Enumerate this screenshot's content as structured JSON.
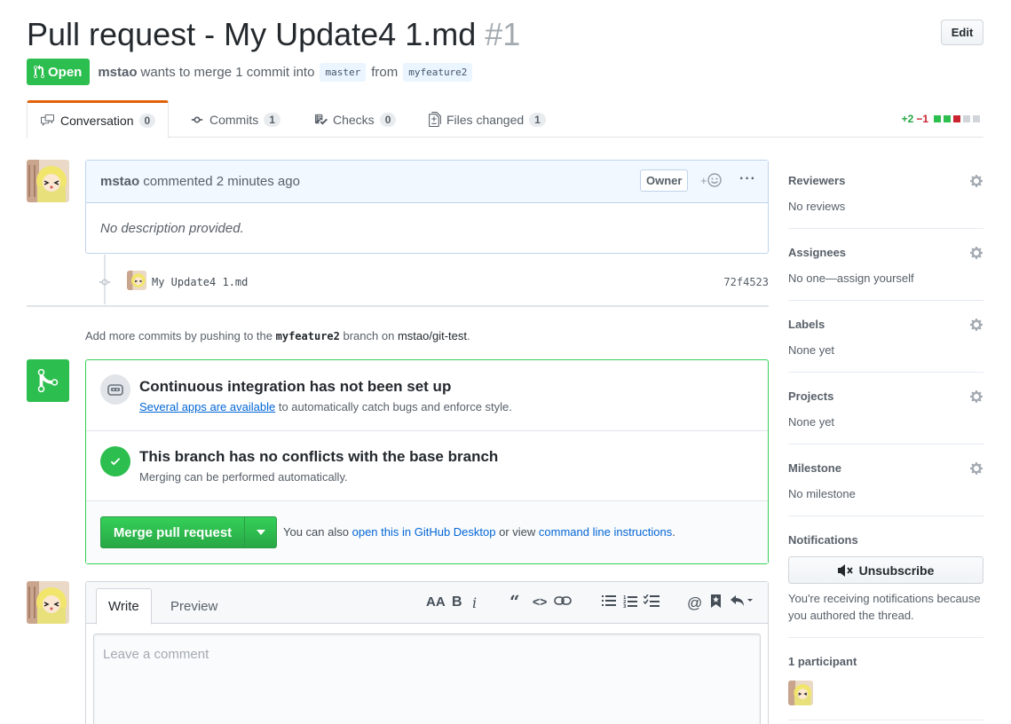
{
  "header": {
    "title": "Pull request - My Update4 1.md",
    "number": "#1",
    "edit_label": "Edit"
  },
  "meta": {
    "state": "Open",
    "author": "mstao",
    "wants_text": "wants to merge 1 commit into",
    "base_branch": "master",
    "from_text": "from",
    "head_branch": "myfeature2"
  },
  "tabs": [
    {
      "label": "Conversation",
      "count": "0"
    },
    {
      "label": "Commits",
      "count": "1"
    },
    {
      "label": "Checks",
      "count": "0"
    },
    {
      "label": "Files changed",
      "count": "1"
    }
  ],
  "diffstat": {
    "additions": "+2",
    "deletions": "−1"
  },
  "comment": {
    "author": "mstao",
    "action": "commented 2 minutes ago",
    "badge": "Owner",
    "body": "No description provided."
  },
  "commit": {
    "message": "My Update4 1.md",
    "sha": "72f4523"
  },
  "push_note": {
    "prefix": "Add more commits by pushing to the",
    "branch": "myfeature2",
    "middle": "branch on",
    "repo": "mstao/git-test",
    "suffix": "."
  },
  "merge_box": {
    "ci_heading": "Continuous integration has not been set up",
    "ci_link": "Several apps are available",
    "ci_sub": "to automatically catch bugs and enforce style.",
    "conflict_heading": "This branch has no conflicts with the base branch",
    "conflict_sub": "Merging can be performed automatically.",
    "merge_button": "Merge pull request",
    "alt_prefix": "You can also",
    "alt_link1": "open this in GitHub Desktop",
    "alt_middle": "or view",
    "alt_link2": "command line instructions",
    "alt_suffix": "."
  },
  "new_comment": {
    "write_tab": "Write",
    "preview_tab": "Preview",
    "placeholder": "Leave a comment"
  },
  "sidebar": {
    "reviewers": {
      "title": "Reviewers",
      "value": "No reviews"
    },
    "assignees": {
      "title": "Assignees",
      "value": "No one—assign yourself"
    },
    "labels": {
      "title": "Labels",
      "value": "None yet"
    },
    "projects": {
      "title": "Projects",
      "value": "None yet"
    },
    "milestone": {
      "title": "Milestone",
      "value": "No milestone"
    },
    "notifications": {
      "title": "Notifications",
      "button": "Unsubscribe",
      "note": "You're receiving notifications because you authored the thread."
    },
    "participants": {
      "title": "1 participant"
    }
  },
  "colors": {
    "open_green": "#2cbe4e",
    "link_blue": "#0366d6",
    "tab_accent": "#e36209",
    "diff_add": "#28a745",
    "diff_del": "#cb2431"
  }
}
